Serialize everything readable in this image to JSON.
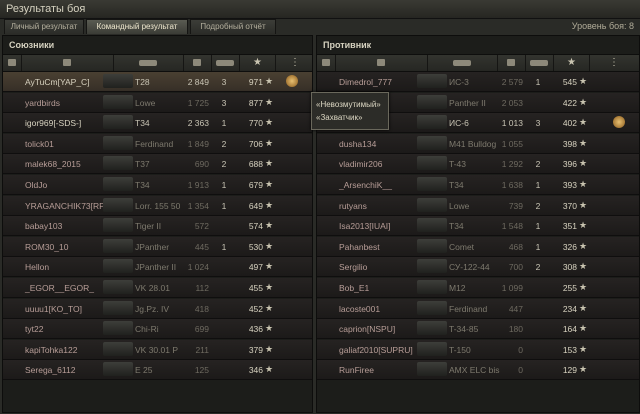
{
  "window": {
    "title": "Результаты боя"
  },
  "tabs": [
    {
      "label": "Личный результат",
      "active": false
    },
    {
      "label": "Командный результат",
      "active": true
    },
    {
      "label": "Подробный отчёт",
      "active": false
    }
  ],
  "battle_level": "Уровень боя: 8",
  "allies": {
    "title": "Союзники",
    "rows": [
      {
        "name": "AyTuCm[YAP_C]",
        "vehicle": "T28",
        "damage": "2 849",
        "kills": "3",
        "xp": "971",
        "alive": true,
        "highlight": true,
        "medal": true
      },
      {
        "name": "yardbirds",
        "vehicle": "Lowe",
        "damage": "1 725",
        "kills": "3",
        "xp": "877",
        "alive": false
      },
      {
        "name": "igor969[-SDS-]",
        "vehicle": "T34",
        "damage": "2 363",
        "kills": "1",
        "xp": "770",
        "alive": true
      },
      {
        "name": "tolick01",
        "vehicle": "Ferdinand",
        "damage": "1 849",
        "kills": "2",
        "xp": "706",
        "alive": false
      },
      {
        "name": "malek68_2015",
        "vehicle": "T37",
        "damage": "690",
        "kills": "2",
        "xp": "688",
        "alive": false
      },
      {
        "name": "OldJo",
        "vehicle": "T34",
        "damage": "1 913",
        "kills": "1",
        "xp": "679",
        "alive": false
      },
      {
        "name": "YRAGANCHIK73[RP-]",
        "vehicle": "Lorr. 155 50",
        "damage": "1 354",
        "kills": "1",
        "xp": "649",
        "alive": false
      },
      {
        "name": "babay103",
        "vehicle": "Tiger II",
        "damage": "572",
        "kills": "",
        "xp": "574",
        "alive": false
      },
      {
        "name": "ROM30_10",
        "vehicle": "JPanther",
        "damage": "445",
        "kills": "1",
        "xp": "530",
        "alive": false
      },
      {
        "name": "Hellon",
        "vehicle": "JPanther II",
        "damage": "1 024",
        "kills": "",
        "xp": "497",
        "alive": false
      },
      {
        "name": "_EGOR__EGOR_",
        "vehicle": "VK 28.01",
        "damage": "112",
        "kills": "",
        "xp": "455",
        "alive": false
      },
      {
        "name": "uuuu1[KO_TO]",
        "vehicle": "Jg.Pz. IV",
        "damage": "418",
        "kills": "",
        "xp": "452",
        "alive": false
      },
      {
        "name": "tyt22",
        "vehicle": "Chi-Ri",
        "damage": "699",
        "kills": "",
        "xp": "436",
        "alive": false
      },
      {
        "name": "kapiTohka122",
        "vehicle": "VK 30.01 P",
        "damage": "211",
        "kills": "",
        "xp": "379",
        "alive": false
      },
      {
        "name": "Serega_6112",
        "vehicle": "E 25",
        "damage": "125",
        "kills": "",
        "xp": "346",
        "alive": false
      }
    ]
  },
  "enemies": {
    "title": "Противник",
    "rows": [
      {
        "name": "Dimedrol_777",
        "vehicle": "ИС-3",
        "damage": "2 579",
        "kills": "1",
        "xp": "545",
        "alive": false
      },
      {
        "name": "",
        "vehicle": "Panther II",
        "damage": "2 053",
        "kills": "",
        "xp": "422",
        "alive": false
      },
      {
        "name": "_IP_]",
        "vehicle": "ИС-6",
        "damage": "1 013",
        "kills": "3",
        "xp": "402",
        "alive": true,
        "medal": true
      },
      {
        "name": "dusha134",
        "vehicle": "M41 Bulldog",
        "damage": "1 055",
        "kills": "",
        "xp": "398",
        "alive": false
      },
      {
        "name": "vladimir206",
        "vehicle": "T-43",
        "damage": "1 292",
        "kills": "2",
        "xp": "396",
        "alive": false
      },
      {
        "name": "_ArsenchiK__",
        "vehicle": "T34",
        "damage": "1 638",
        "kills": "1",
        "xp": "393",
        "alive": false
      },
      {
        "name": "rutyans",
        "vehicle": "Lowe",
        "damage": "739",
        "kills": "2",
        "xp": "370",
        "alive": false
      },
      {
        "name": "Isa2013[IUAI]",
        "vehicle": "T34",
        "damage": "1 548",
        "kills": "1",
        "xp": "351",
        "alive": false
      },
      {
        "name": "Pahanbest",
        "vehicle": "Comet",
        "damage": "468",
        "kills": "1",
        "xp": "326",
        "alive": false
      },
      {
        "name": "Sergilio",
        "vehicle": "СУ-122-44",
        "damage": "700",
        "kills": "2",
        "xp": "308",
        "alive": false
      },
      {
        "name": "Bob_E1",
        "vehicle": "M12",
        "damage": "1 099",
        "kills": "",
        "xp": "255",
        "alive": false
      },
      {
        "name": "lacoste001",
        "vehicle": "Ferdinand",
        "damage": "447",
        "kills": "",
        "xp": "234",
        "alive": false
      },
      {
        "name": "caprion[NSPU]",
        "vehicle": "T-34-85",
        "damage": "180",
        "kills": "",
        "xp": "164",
        "alive": false
      },
      {
        "name": "galiaf2010[SUPRU]",
        "vehicle": "T-150",
        "damage": "0",
        "kills": "",
        "xp": "153",
        "alive": false
      },
      {
        "name": "RunFiree",
        "vehicle": "AMX ELC bis",
        "damage": "0",
        "kills": "",
        "xp": "129",
        "alive": false
      }
    ]
  },
  "tooltip": {
    "line1": "«Невозмутимый»",
    "line2": "«Захватчик»"
  },
  "icons": {
    "star": "star-icon",
    "sort": "sort-arrow-icon",
    "medal": "medal-icon"
  },
  "colors": {
    "accent": "#e8c071",
    "alive_text": "#d8d3c0",
    "dead_text": "#b89e98"
  }
}
